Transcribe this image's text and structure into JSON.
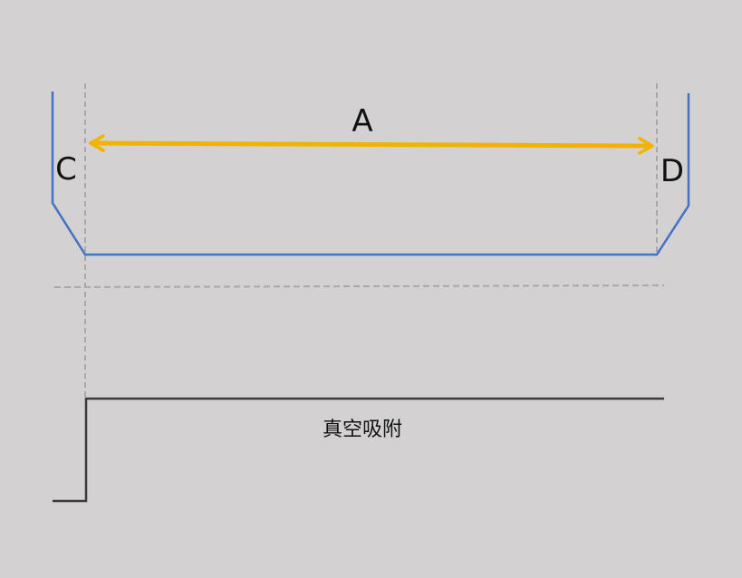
{
  "labels": {
    "a": "A",
    "c": "C",
    "d": "D",
    "signal": "真空吸附"
  },
  "colors": {
    "background": "#d3d1d2",
    "profile": "#4472c4",
    "arrow": "#f0b400",
    "guide": "#a8a8a8",
    "signal": "#3a3a3a",
    "text": "#111111"
  }
}
